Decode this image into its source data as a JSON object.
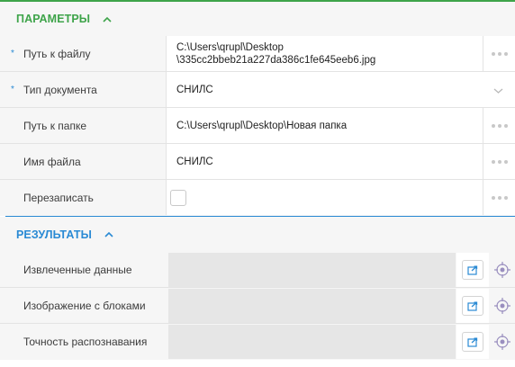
{
  "params": {
    "title": "ПАРАМЕТРЫ",
    "rows": [
      {
        "label": "Путь к файлу",
        "required": "*",
        "value_line1": "C:\\Users\\qrupl\\Desktop",
        "value_line2": "\\335cc2bbeb21a227da386c1fe645eeb6.jpg"
      },
      {
        "label": "Тип документа",
        "required": "*",
        "value": "СНИЛС"
      },
      {
        "label": "Путь к папке",
        "value": "C:\\Users\\qrupl\\Desktop\\Новая папка"
      },
      {
        "label": "Имя файла",
        "value": "СНИЛС"
      },
      {
        "label": "Перезаписать",
        "checked": false
      }
    ]
  },
  "results": {
    "title": "РЕЗУЛЬТАТЫ",
    "rows": [
      {
        "label": "Извлеченные данные"
      },
      {
        "label": "Изображение с блоками"
      },
      {
        "label": "Точность распознавания"
      }
    ]
  },
  "colors": {
    "params_accent": "#3ea44a",
    "results_accent": "#2a8ad4",
    "required_mark": "#2a8ad4",
    "row_bg": "#f6f6f6",
    "field_bg": "#ffffff",
    "result_field_bg": "#e6e6e6"
  },
  "icons": {
    "collapse": "chevron-up-icon",
    "select": "chevron-down-icon",
    "more": "ellipsis-icon",
    "open": "open-external-icon",
    "target": "crosshair-target-icon"
  }
}
